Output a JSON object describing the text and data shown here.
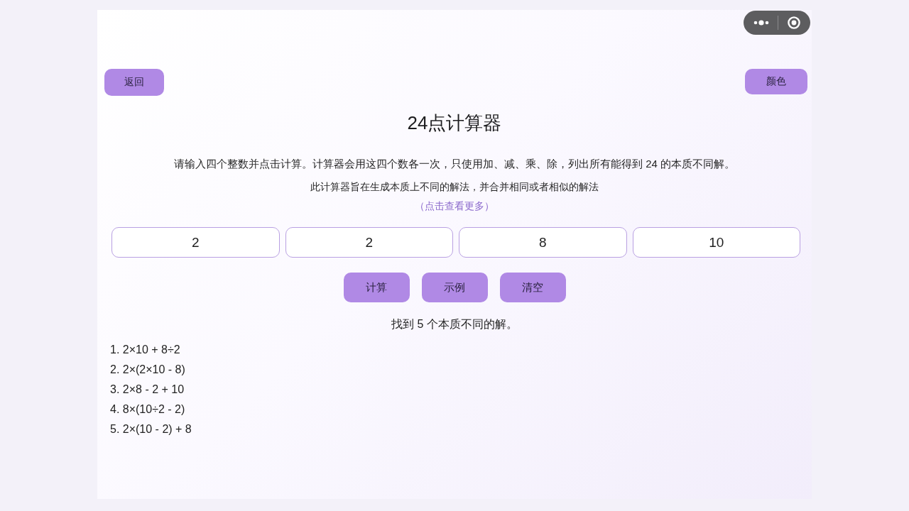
{
  "nav": {
    "back_button": "返回",
    "color_button": "颜色"
  },
  "title": "24点计算器",
  "description": "请输入四个整数并点击计算。计算器会用这四个数各一次，只使用加、减、乘、除，列出所有能得到 24 的本质不同解。",
  "note": "此计算器旨在生成本质上不同的解法，并合并相同或者相似的解法",
  "more_link": "（点击查看更多）",
  "inputs": [
    {
      "value": "2"
    },
    {
      "value": "2"
    },
    {
      "value": "8"
    },
    {
      "value": "10"
    }
  ],
  "buttons": [
    "计算",
    "示例",
    "清空"
  ],
  "result_summary": "找到 5 个本质不同的解。",
  "solutions": [
    "1. 2×10 + 8÷2",
    "2. 2×(2×10 - 8)",
    "3. 2×8 - 2 + 10",
    "4. 8×(10÷2 - 2)",
    "5. 2×(10 - 2) + 8"
  ]
}
